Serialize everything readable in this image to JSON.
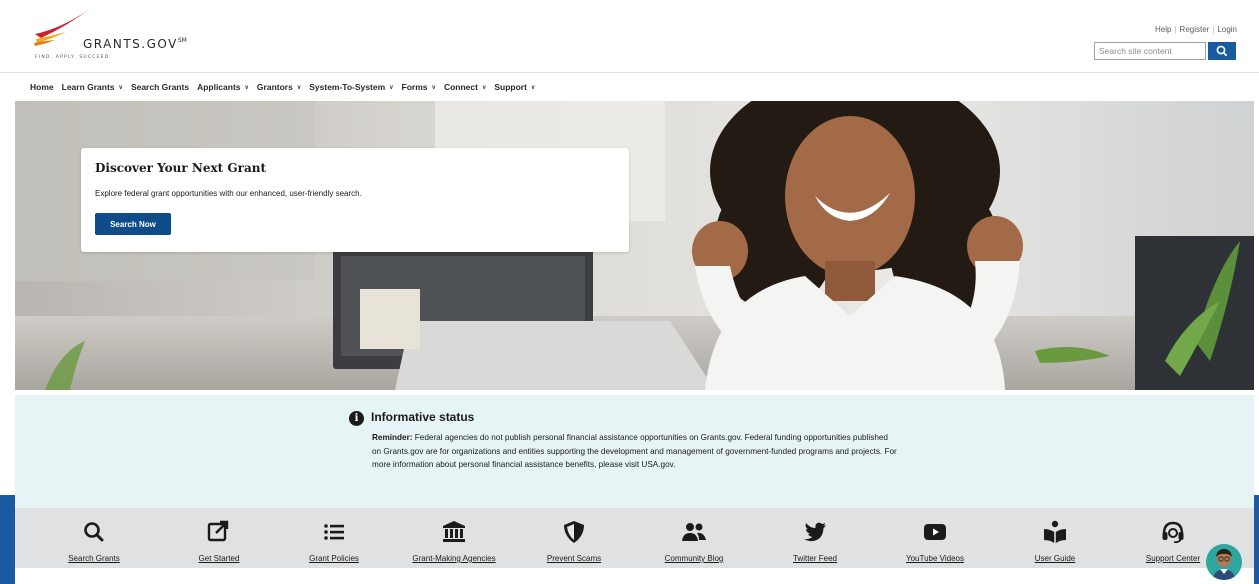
{
  "site": {
    "logo_text": "GRANTS.GOV",
    "logo_mark": "SM",
    "tagline": "FIND. APPLY. SUCCEED."
  },
  "utility_links": {
    "help": "Help",
    "register": "Register",
    "login": "Login"
  },
  "search": {
    "placeholder": "Search site content",
    "button_icon": "search-icon"
  },
  "nav": [
    {
      "label": "Home",
      "dropdown": false
    },
    {
      "label": "Learn Grants",
      "dropdown": true
    },
    {
      "label": "Search Grants",
      "dropdown": false
    },
    {
      "label": "Applicants",
      "dropdown": true
    },
    {
      "label": "Grantors",
      "dropdown": true
    },
    {
      "label": "System-To-System",
      "dropdown": true
    },
    {
      "label": "Forms",
      "dropdown": true
    },
    {
      "label": "Connect",
      "dropdown": true
    },
    {
      "label": "Support",
      "dropdown": true
    }
  ],
  "hero": {
    "title": "Discover Your Next Grant",
    "subtitle": "Explore federal grant opportunities with our enhanced, user-friendly search.",
    "button": "Search Now"
  },
  "alert": {
    "title": "Informative status",
    "lead": "Reminder:",
    "body": "Federal agencies do not publish personal financial assistance opportunities on Grants.gov. Federal funding opportunities published on Grants.gov are for organizations and entities supporting the development and management of government-funded programs and projects. For more information about personal financial assistance benefits, please visit USA.gov."
  },
  "quick_links": [
    {
      "label": "Search Grants",
      "icon": "search-icon"
    },
    {
      "label": "Get Started",
      "icon": "external-link-icon"
    },
    {
      "label": "Grant Policies",
      "icon": "list-icon"
    },
    {
      "label": "Grant-Making Agencies",
      "icon": "bank-icon"
    },
    {
      "label": "Prevent Scams",
      "icon": "shield-icon"
    },
    {
      "label": "Community Blog",
      "icon": "people-icon"
    },
    {
      "label": "Twitter Feed",
      "icon": "twitter-icon"
    },
    {
      "label": "YouTube Videos",
      "icon": "youtube-icon"
    },
    {
      "label": "User Guide",
      "icon": "book-reader-icon"
    },
    {
      "label": "Support Center",
      "icon": "headset-icon"
    }
  ],
  "colors": {
    "brand_blue": "#1a5aa0",
    "button_blue": "#0f4c8a",
    "alert_bg": "#e6f4f6",
    "links_bar_bg": "#dfe1e2",
    "logo_red": "#c8202f",
    "logo_orange": "#f5a623"
  }
}
